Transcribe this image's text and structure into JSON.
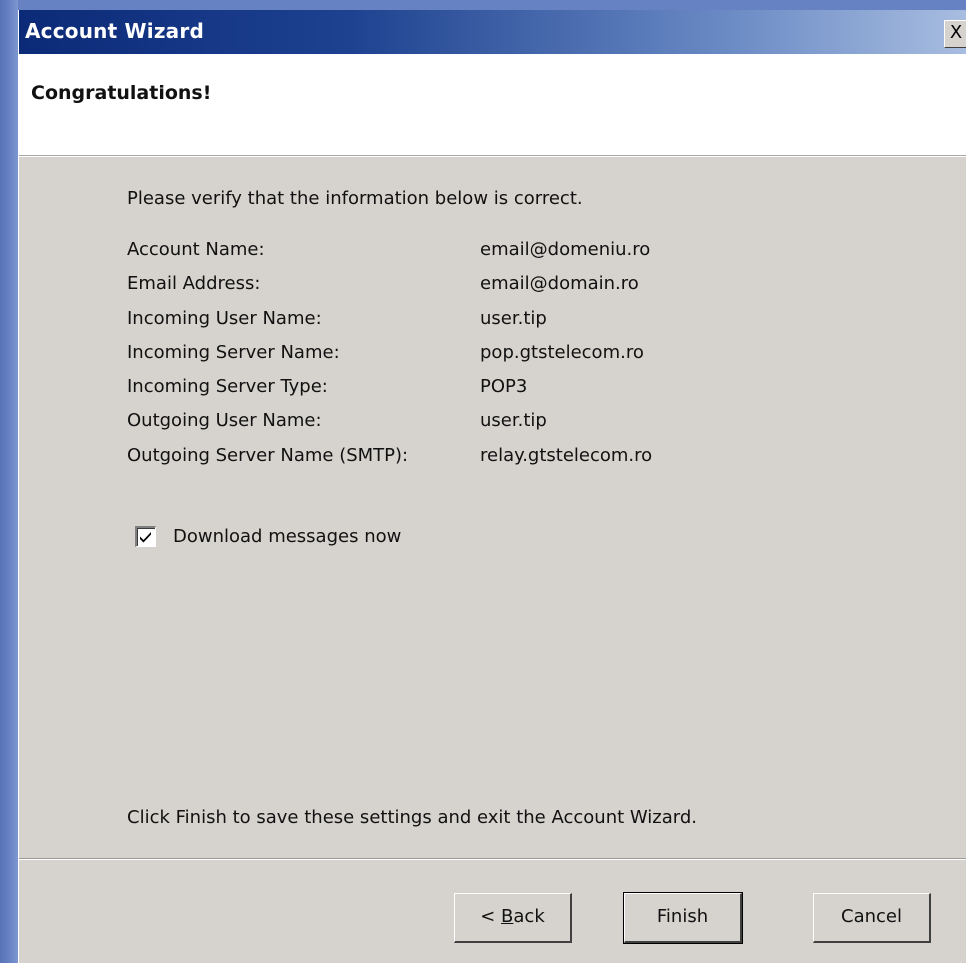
{
  "window": {
    "title": "Account Wizard",
    "close_label": "X"
  },
  "header": {
    "title": "Congratulations!"
  },
  "intro_text": "Please verify that the information below is correct.",
  "info_rows": [
    {
      "label": "Account Name:",
      "value": "email@domeniu.ro"
    },
    {
      "label": "Email Address:",
      "value": "email@domain.ro"
    },
    {
      "label": "Incoming User Name:",
      "value": "user.tip"
    },
    {
      "label": "Incoming Server Name:",
      "value": "pop.gtstelecom.ro"
    },
    {
      "label": "Incoming Server Type:",
      "value": "POP3"
    },
    {
      "label": "Outgoing User Name:",
      "value": "user.tip"
    },
    {
      "label": "Outgoing Server Name (SMTP):",
      "value": "relay.gtstelecom.ro"
    }
  ],
  "download_checkbox": {
    "label": "Download messages now",
    "checked": true
  },
  "footer_text": "Click Finish to save these settings and exit the Account Wizard.",
  "buttons": {
    "back_prefix": "< ",
    "back_accel": "B",
    "back_rest": "ack",
    "finish": "Finish",
    "cancel": "Cancel"
  },
  "colors": {
    "titlebar_start": "#0b2a78",
    "titlebar_end": "#a8bde0",
    "dialog_bg": "#d6d3ce",
    "header_bg": "#ffffff"
  }
}
